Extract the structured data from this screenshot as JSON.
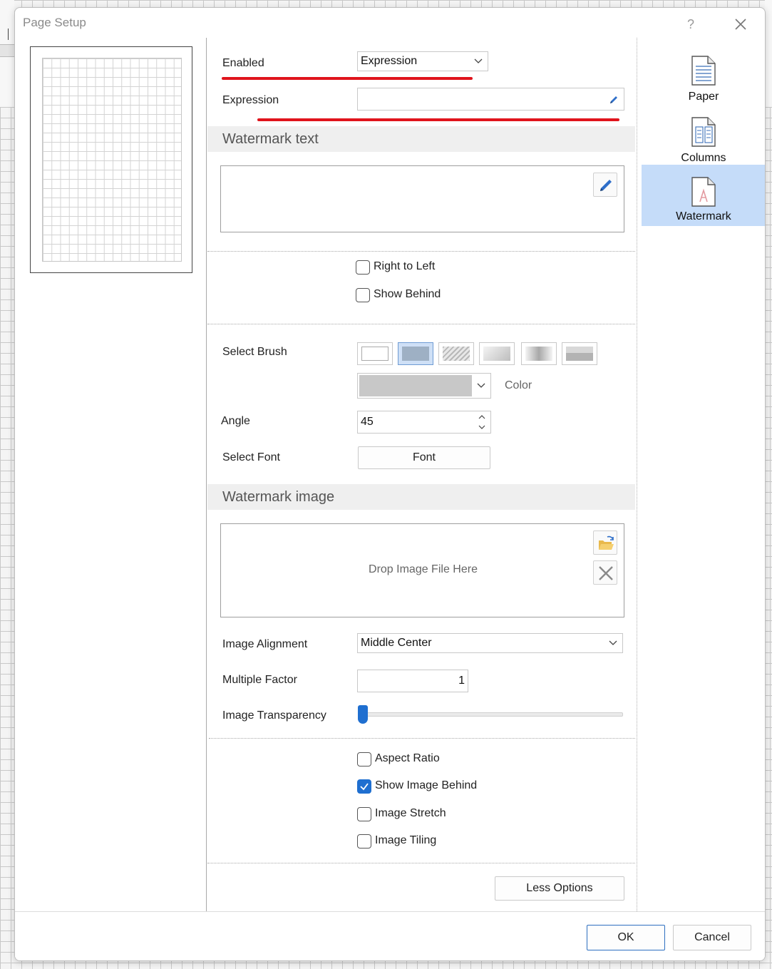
{
  "dialog": {
    "title": "Page Setup",
    "help": "?"
  },
  "nav": [
    {
      "label": "Paper",
      "icon": "paper-page-icon"
    },
    {
      "label": "Columns",
      "icon": "columns-page-icon"
    },
    {
      "label": "Watermark",
      "icon": "watermark-page-icon"
    }
  ],
  "enabled": {
    "label": "Enabled",
    "value": "Expression"
  },
  "expression": {
    "label": "Expression",
    "value": ""
  },
  "watermark_text": {
    "header": "Watermark text",
    "value": "",
    "right_to_left": "Right to Left",
    "show_behind": "Show Behind",
    "select_brush": "Select Brush",
    "color_label": "Color",
    "color_value": "#c8c8c8",
    "angle_label": "Angle",
    "angle_value": "45",
    "select_font": "Select Font",
    "font_button": "Font"
  },
  "watermark_image": {
    "header": "Watermark image",
    "drop_text": "Drop Image File Here",
    "alignment_label": "Image Alignment",
    "alignment_value": "Middle Center",
    "multiple_label": "Multiple Factor",
    "multiple_value": "1",
    "transparency_label": "Image Transparency",
    "transparency_value": 0,
    "aspect_ratio": "Aspect Ratio",
    "show_image_behind": "Show Image Behind",
    "image_stretch": "Image Stretch",
    "image_tiling": "Image Tiling"
  },
  "checkbox_states": {
    "right_to_left": false,
    "show_behind": false,
    "aspect_ratio": false,
    "show_image_behind": true,
    "image_stretch": false,
    "image_tiling": false
  },
  "buttons": {
    "less_options": "Less Options",
    "ok": "OK",
    "cancel": "Cancel"
  },
  "colors": {
    "accent": "#1f6fd0",
    "selected_nav": "#c5dcf9",
    "annotation_red": "#e0141c"
  }
}
